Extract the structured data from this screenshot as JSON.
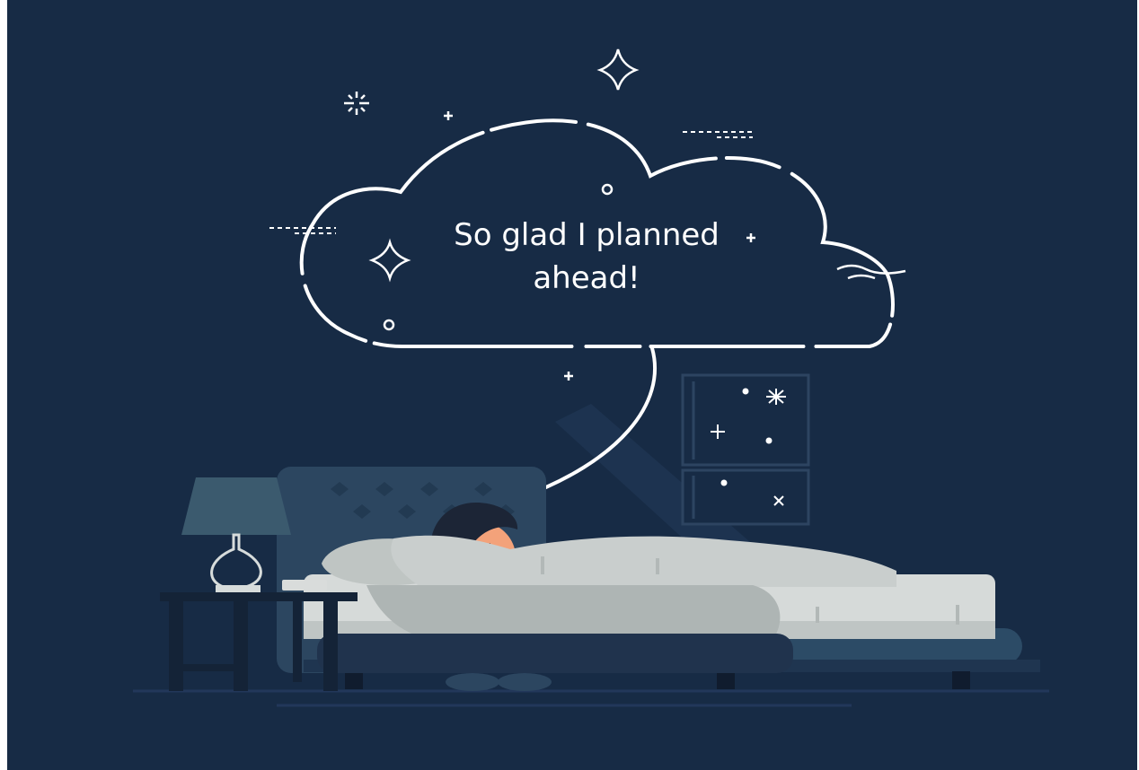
{
  "thought_bubble": {
    "line1": "So glad I planned",
    "line2": "ahead!"
  },
  "colors": {
    "background": "#172b45",
    "bubble_stroke": "#ffffff",
    "blanket": "#c7cccb",
    "headboard": "#2f4a63",
    "lamp_shade": "#3b5a6e",
    "skin": "#f3a27a",
    "hair": "#1c2536"
  },
  "icons": [
    "sparkle-icon",
    "plus-icon",
    "circle-icon",
    "asterisk-icon",
    "wave-icon"
  ]
}
